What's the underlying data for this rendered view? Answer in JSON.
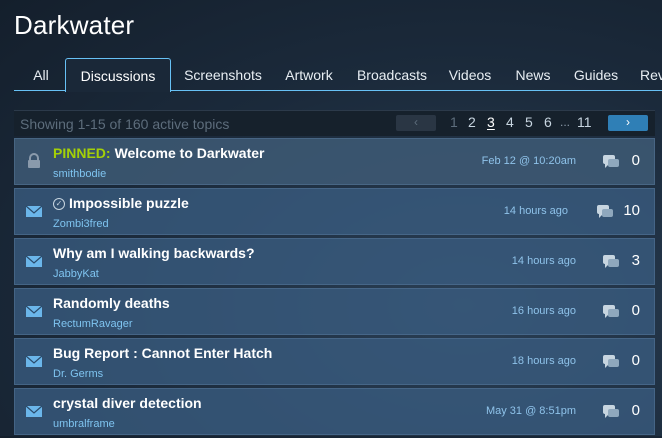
{
  "app": {
    "title": "Darkwater"
  },
  "tabs": [
    {
      "label": "All"
    },
    {
      "label": "Discussions",
      "active": true
    },
    {
      "label": "Screenshots"
    },
    {
      "label": "Artwork"
    },
    {
      "label": "Broadcasts"
    },
    {
      "label": "Videos"
    },
    {
      "label": "News"
    },
    {
      "label": "Guides"
    },
    {
      "label": "Rev"
    }
  ],
  "listing": {
    "summary": "Showing 1-15 of 160 active topics",
    "pagination": {
      "prev_icon": "chevron-left-icon",
      "next_icon": "chevron-right-icon",
      "pages": [
        "1",
        "2",
        "3",
        "4",
        "5",
        "6",
        "...",
        "11"
      ],
      "current": "3"
    }
  },
  "topics": [
    {
      "pinned_label": "PINNED:",
      "title": "Welcome to Darkwater",
      "author": "smithbodie",
      "time": "Feb 12 @ 10:20am",
      "replies": "0",
      "icon": "lock-icon",
      "answered": false
    },
    {
      "title": "Impossible puzzle",
      "author": "Zombi3fred",
      "time": "14 hours ago",
      "replies": "10",
      "icon": "envelope-icon",
      "answered": true
    },
    {
      "title": "Why am I walking backwards?",
      "author": "JabbyKat",
      "time": "14 hours ago",
      "replies": "3",
      "icon": "envelope-icon",
      "answered": false
    },
    {
      "title": "Randomly deaths",
      "author": "RectumRavager",
      "time": "16 hours ago",
      "replies": "0",
      "icon": "envelope-icon",
      "answered": false
    },
    {
      "title": "Bug Report : Cannot Enter Hatch",
      "author": "Dr. Germs",
      "time": "18 hours ago",
      "replies": "0",
      "icon": "envelope-icon",
      "answered": false
    },
    {
      "title": "crystal diver detection",
      "author": "umbralframe",
      "time": "May 31 @ 8:51pm",
      "replies": "0",
      "icon": "envelope-icon",
      "answered": false
    }
  ],
  "colors": {
    "accent": "#67c1f5",
    "pinned": "#a4d007",
    "row_bg": "#3a5c80",
    "author": "#7fc4f0"
  }
}
